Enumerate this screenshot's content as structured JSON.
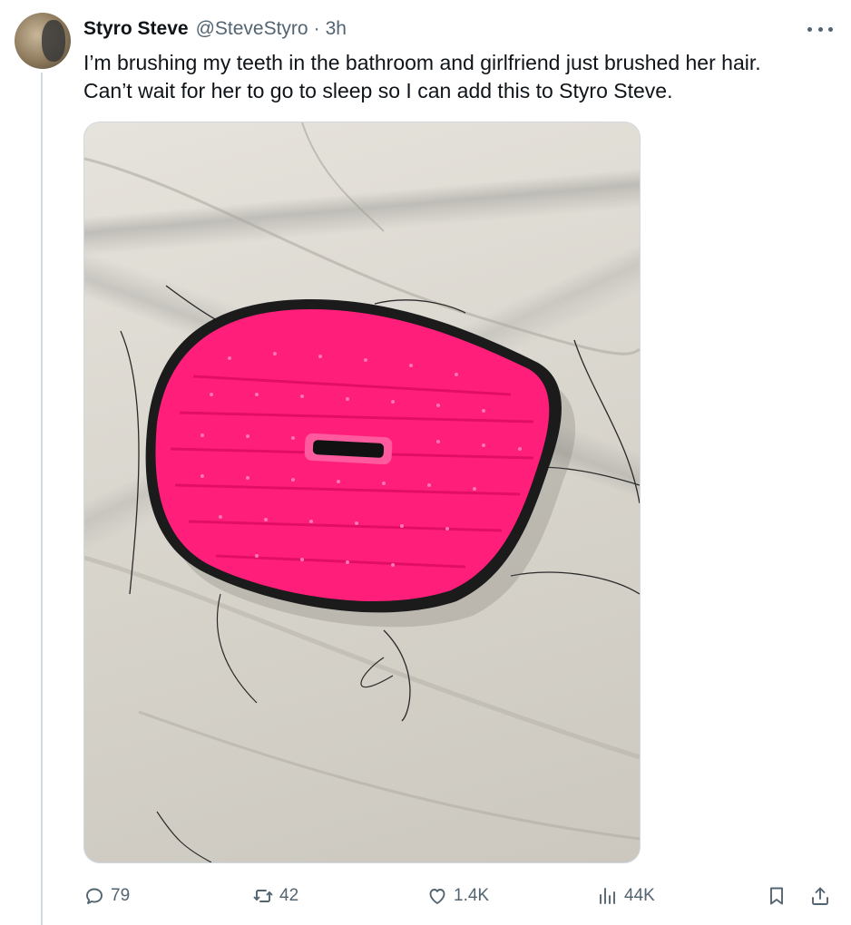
{
  "tweet": {
    "author_name": "Styro Steve",
    "handle": "@SteveStyro",
    "separator": "·",
    "time": "3h",
    "text_lines": [
      "I’m brushing my teeth in the bathroom and girlfriend just brushed her hair.",
      "Can’t wait for her to go to sleep so I can add this to Styro Steve."
    ],
    "media_description": "photo",
    "more_icon": "ellipsis-icon"
  },
  "actions": {
    "reply_count": "79",
    "repost_count": "42",
    "like_count": "1.4K",
    "views_count": "44K"
  },
  "colors": {
    "brush_pink": "#ff1f7a",
    "secondary_text": "#536471",
    "thread_line": "#cfd9de"
  }
}
